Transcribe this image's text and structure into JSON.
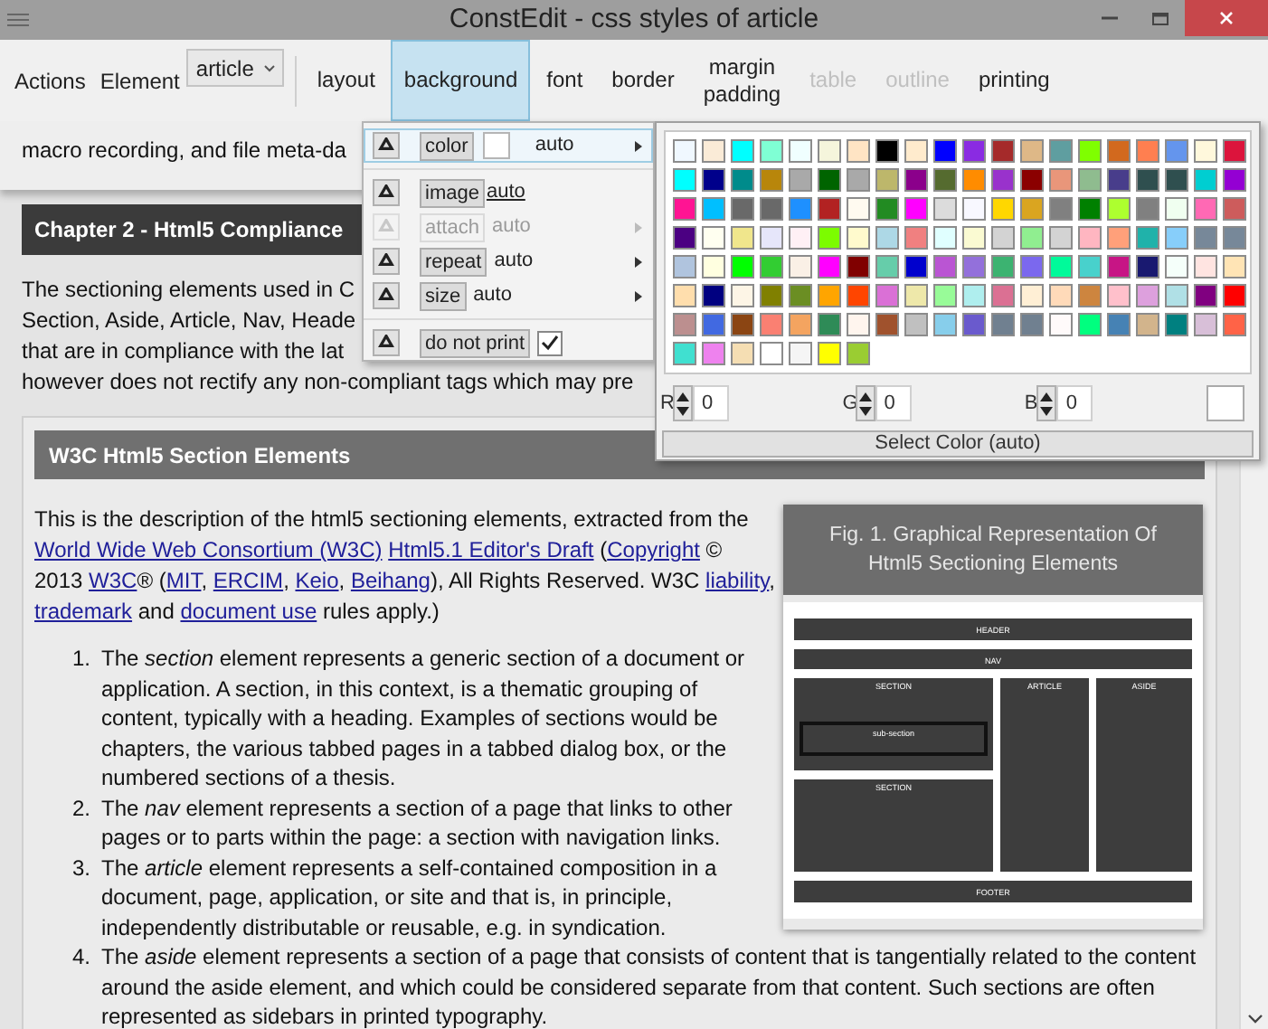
{
  "window": {
    "title": "ConstEdit - css styles of article"
  },
  "toolbar": {
    "actions": "Actions",
    "element_label": "Element",
    "element": "article",
    "tabs": [
      {
        "label": "layout",
        "selected": false,
        "disabled": false
      },
      {
        "label": "background",
        "selected": true,
        "disabled": false
      },
      {
        "label": "font",
        "selected": false,
        "disabled": false
      },
      {
        "label": "border",
        "selected": false,
        "disabled": false
      },
      {
        "label": "margin\npadding",
        "selected": false,
        "disabled": false
      },
      {
        "label": "table",
        "selected": false,
        "disabled": true
      },
      {
        "label": "outline",
        "selected": false,
        "disabled": true
      },
      {
        "label": "printing",
        "selected": false,
        "disabled": false
      }
    ]
  },
  "document": {
    "intro_line": "macro recording, and file meta-da",
    "chapter_heading": "Chapter 2 - Html5 Compliance",
    "chapter_lines": [
      "The sectioning elements used in C",
      "Section, Aside, Article, Nav, Heade",
      "that are in compliance with the lat",
      "however does not rectify any non-compliant tags which may pre"
    ],
    "section_heading": "W3C Html5 Section Elements",
    "description": [
      [
        {
          "text": "This is the description of the html5 sectioning elements, extracted from the",
          "link": false
        }
      ],
      [
        {
          "text": "World Wide Web Consortium (W3C)",
          "link": true
        },
        {
          "text": "Html5.1 Editor's Draft",
          "link": true
        },
        {
          "text": " (",
          "link": false
        },
        {
          "text": "Copyright",
          "link": true
        },
        {
          "text": " ©",
          "link": false
        }
      ],
      [
        {
          "text": "2013 ",
          "link": false
        },
        {
          "text": "W3C",
          "link": true
        },
        {
          "text": "® (",
          "link": false
        },
        {
          "text": "MIT",
          "link": true
        },
        {
          "text": ", ",
          "link": false
        },
        {
          "text": "ERCIM",
          "link": true
        },
        {
          "text": ", ",
          "link": false
        },
        {
          "text": "Keio",
          "link": true
        },
        {
          "text": ", ",
          "link": false
        },
        {
          "text": "Beihang",
          "link": true
        },
        {
          "text": "), All Rights Reserved. W3C ",
          "link": false
        },
        {
          "text": "liability",
          "link": true
        },
        {
          "text": ",",
          "link": false
        }
      ],
      [
        {
          "text": "trademark",
          "link": true
        },
        {
          "text": " and ",
          "link": false
        },
        {
          "text": "document use",
          "link": true
        },
        {
          "text": " rules apply.)",
          "link": false
        }
      ]
    ],
    "figure": {
      "caption": [
        "Fig. 1. Graphical Representation Of",
        "Html5 Sectioning Elements"
      ],
      "diagram": {
        "header": "HEADER",
        "nav": "NAV",
        "sections": [
          {
            "label": "SECTION",
            "subsection": "sub-section"
          },
          {
            "label": "SECTION"
          }
        ],
        "article": "ARTICLE",
        "aside": "ASIDE",
        "footer": "FOOTER"
      }
    },
    "list": [
      {
        "number": "1.",
        "text": "The *section* element represents a generic section of a document or application. A section, in this context, is a thematic grouping of content, typically with a heading. Examples of sections would be chapters, the various tabbed pages in a tabbed dialog box, or the numbered sections of a thesis."
      },
      {
        "number": "2.",
        "text": "The *nav* element represents a section of a page that links to other pages or to parts within the page: a section with navigation links."
      },
      {
        "number": "3.",
        "text": "The *article* element represents a self-contained composition in a document, page, application, or site and that is, in principle, independently distributable or reusable, e.g. in syndication."
      },
      {
        "number": "4.",
        "text": "The *aside* element represents a section of a page that consists of content that is tangentially related to the content around the aside element, and which could be considered separate from that content. Such sections are often represented as sidebars in printed typography."
      }
    ]
  },
  "background_menu": {
    "groups": [
      [
        {
          "label": "color",
          "kind": "color",
          "value": "auto",
          "submenu": true,
          "disabled": false,
          "selected": true
        }
      ],
      [
        {
          "label": "image",
          "kind": "link",
          "value": "auto",
          "submenu": false,
          "disabled": false,
          "selected": false
        },
        {
          "label": "attach",
          "kind": "text",
          "value": "auto",
          "submenu": true,
          "disabled": true,
          "selected": false
        },
        {
          "label": "repeat",
          "kind": "text",
          "value": "auto",
          "submenu": true,
          "disabled": false,
          "selected": false
        },
        {
          "label": "size",
          "kind": "text",
          "value": "auto",
          "submenu": true,
          "disabled": false,
          "selected": false
        }
      ],
      [
        {
          "label": "do not print",
          "kind": "checkbox",
          "checked": true,
          "submenu": false,
          "disabled": false,
          "selected": false
        }
      ]
    ]
  },
  "color_picker": {
    "swatches": [
      {
        "color": "#f0f8ff"
      },
      {
        "color": "#faebd7"
      },
      {
        "color": "#00ffff"
      },
      {
        "color": "#7fffd4"
      },
      {
        "color": "#f0ffff"
      },
      {
        "color": "#f5f5dc"
      },
      {
        "color": "#ffe4c4"
      },
      {
        "color": "#000000"
      },
      {
        "color": "#ffebcd"
      },
      {
        "color": "#0000ff"
      },
      {
        "color": "#8a2be2"
      },
      {
        "color": "#a52a2a"
      },
      {
        "color": "#deb887"
      },
      {
        "color": "#5f9ea0"
      },
      {
        "color": "#7fff00"
      },
      {
        "color": "#d2691e"
      },
      {
        "color": "#ff7f50"
      },
      {
        "color": "#6495ed"
      },
      {
        "color": "#fff8dc"
      },
      {
        "color": "#dc143c"
      },
      {
        "color": "#00ffff"
      },
      {
        "color": "#00008b"
      },
      {
        "color": "#008b8b"
      },
      {
        "color": "#b8860b"
      },
      {
        "color": "#a9a9a9"
      },
      {
        "color": "#006400"
      },
      {
        "color": "#a9a9a9"
      },
      {
        "color": "#bdb76b"
      },
      {
        "color": "#8b008b"
      },
      {
        "color": "#556b2f"
      },
      {
        "color": "#ff8c00"
      },
      {
        "color": "#9932cc"
      },
      {
        "color": "#8b0000"
      },
      {
        "color": "#e9967a"
      },
      {
        "color": "#8fbc8f"
      },
      {
        "color": "#483d8b"
      },
      {
        "color": "#2f4f4f"
      },
      {
        "color": "#2f4f4f"
      },
      {
        "color": "#00ced1"
      },
      {
        "color": "#9400d3"
      },
      {
        "color": "#ff1493"
      },
      {
        "color": "#00bfff"
      },
      {
        "color": "#696969"
      },
      {
        "color": "#696969"
      },
      {
        "color": "#1e90ff"
      },
      {
        "color": "#b22222"
      },
      {
        "color": "#fffaf0"
      },
      {
        "color": "#228b22"
      },
      {
        "color": "#ff00ff"
      },
      {
        "color": "#dcdcdc"
      },
      {
        "color": "#f8f8ff"
      },
      {
        "color": "#ffd700"
      },
      {
        "color": "#daa520"
      },
      {
        "color": "#808080"
      },
      {
        "color": "#008000"
      },
      {
        "color": "#adff2f"
      },
      {
        "color": "#808080"
      },
      {
        "color": "#f0fff0"
      },
      {
        "color": "#ff69b4"
      },
      {
        "color": "#cd5c5c"
      },
      {
        "color": "#4b0082"
      },
      {
        "color": "#fffff0"
      },
      {
        "color": "#f0e68c"
      },
      {
        "color": "#e6e6fa"
      },
      {
        "color": "#fff0f5"
      },
      {
        "color": "#7cfc00"
      },
      {
        "color": "#fffacd"
      },
      {
        "color": "#add8e6"
      },
      {
        "color": "#f08080"
      },
      {
        "color": "#e0ffff"
      },
      {
        "color": "#fafad2"
      },
      {
        "color": "#d3d3d3"
      },
      {
        "color": "#90ee90"
      },
      {
        "color": "#d3d3d3"
      },
      {
        "color": "#ffb6c1"
      },
      {
        "color": "#ffa07a"
      },
      {
        "color": "#20b2aa"
      },
      {
        "color": "#87cefa"
      },
      {
        "color": "#778899"
      },
      {
        "color": "#778899"
      },
      {
        "color": "#b0c4de"
      },
      {
        "color": "#ffffe0"
      },
      {
        "color": "#00ff00"
      },
      {
        "color": "#32cd32"
      },
      {
        "color": "#faf0e6"
      },
      {
        "color": "#ff00ff"
      },
      {
        "color": "#800000"
      },
      {
        "color": "#66cdaa"
      },
      {
        "color": "#0000cd"
      },
      {
        "color": "#ba55d3"
      },
      {
        "color": "#9370db"
      },
      {
        "color": "#3cb371"
      },
      {
        "color": "#7b68ee"
      },
      {
        "color": "#00fa9a"
      },
      {
        "color": "#48d1cc"
      },
      {
        "color": "#c71585"
      },
      {
        "color": "#191970"
      },
      {
        "color": "#f5fffa"
      },
      {
        "color": "#ffe4e1"
      },
      {
        "color": "#ffe4b5"
      },
      {
        "color": "#ffdead"
      },
      {
        "color": "#000080"
      },
      {
        "color": "#fdf5e6"
      },
      {
        "color": "#808000"
      },
      {
        "color": "#6b8e23"
      },
      {
        "color": "#ffa500"
      },
      {
        "color": "#ff4500"
      },
      {
        "color": "#da70d6"
      },
      {
        "color": "#eee8aa"
      },
      {
        "color": "#98fb98"
      },
      {
        "color": "#afeeee"
      },
      {
        "color": "#db7093"
      },
      {
        "color": "#ffefd5"
      },
      {
        "color": "#ffdab9"
      },
      {
        "color": "#cd853f"
      },
      {
        "color": "#ffc0cb"
      },
      {
        "color": "#dda0dd"
      },
      {
        "color": "#b0e0e6"
      },
      {
        "color": "#800080"
      },
      {
        "color": "#ff0000"
      },
      {
        "color": "#bc8f8f"
      },
      {
        "color": "#4169e1"
      },
      {
        "color": "#8b4513"
      },
      {
        "color": "#fa8072"
      },
      {
        "color": "#f4a460"
      },
      {
        "color": "#2e8b57"
      },
      {
        "color": "#fff5ee"
      },
      {
        "color": "#a0522d"
      },
      {
        "color": "#c0c0c0"
      },
      {
        "color": "#87ceeb"
      },
      {
        "color": "#6a5acd"
      },
      {
        "color": "#708090"
      },
      {
        "color": "#708090"
      },
      {
        "color": "#fffafa"
      },
      {
        "color": "#00ff7f"
      },
      {
        "color": "#4682b4"
      },
      {
        "color": "#d2b48c"
      },
      {
        "color": "#008080"
      },
      {
        "color": "#d8bfd8"
      },
      {
        "color": "#ff6347"
      },
      {
        "color": "#40e0d0"
      },
      {
        "color": "#ee82ee"
      },
      {
        "color": "#f5deb3"
      },
      {
        "color": "#ffffff"
      },
      {
        "color": "#f5f5f5"
      },
      {
        "color": "#ffff00"
      },
      {
        "color": "#9acd32"
      }
    ],
    "channels": [
      {
        "label": "R",
        "value": "0"
      },
      {
        "label": "G",
        "value": "0"
      },
      {
        "label": "B",
        "value": "0"
      }
    ],
    "select_button": "Select Color (auto)"
  }
}
